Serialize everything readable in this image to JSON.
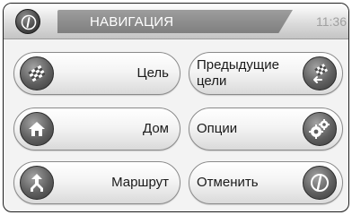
{
  "header": {
    "title": "НАВИГАЦИЯ",
    "time": "11:36",
    "menu_icon": "back-info-icon"
  },
  "buttons": {
    "destination": {
      "label": "Цель",
      "icon": "checkered-flag-icon"
    },
    "previous_destinations": {
      "label": "Предыдущие\nцели",
      "label_line1": "Предыдущие",
      "label_line2": "цели",
      "icon": "previous-destinations-icon"
    },
    "home": {
      "label": "Дом",
      "icon": "home-icon"
    },
    "options": {
      "label": "Опции",
      "icon": "gears-icon"
    },
    "route": {
      "label": "Маршрут",
      "icon": "route-sign-icon"
    },
    "cancel": {
      "label": "Отменить",
      "icon": "cancel-route-icon"
    }
  },
  "colors": {
    "header_tab": "#8f8f8f",
    "icon_disc": "#5f5f5f",
    "text": "#1a1a1a"
  }
}
